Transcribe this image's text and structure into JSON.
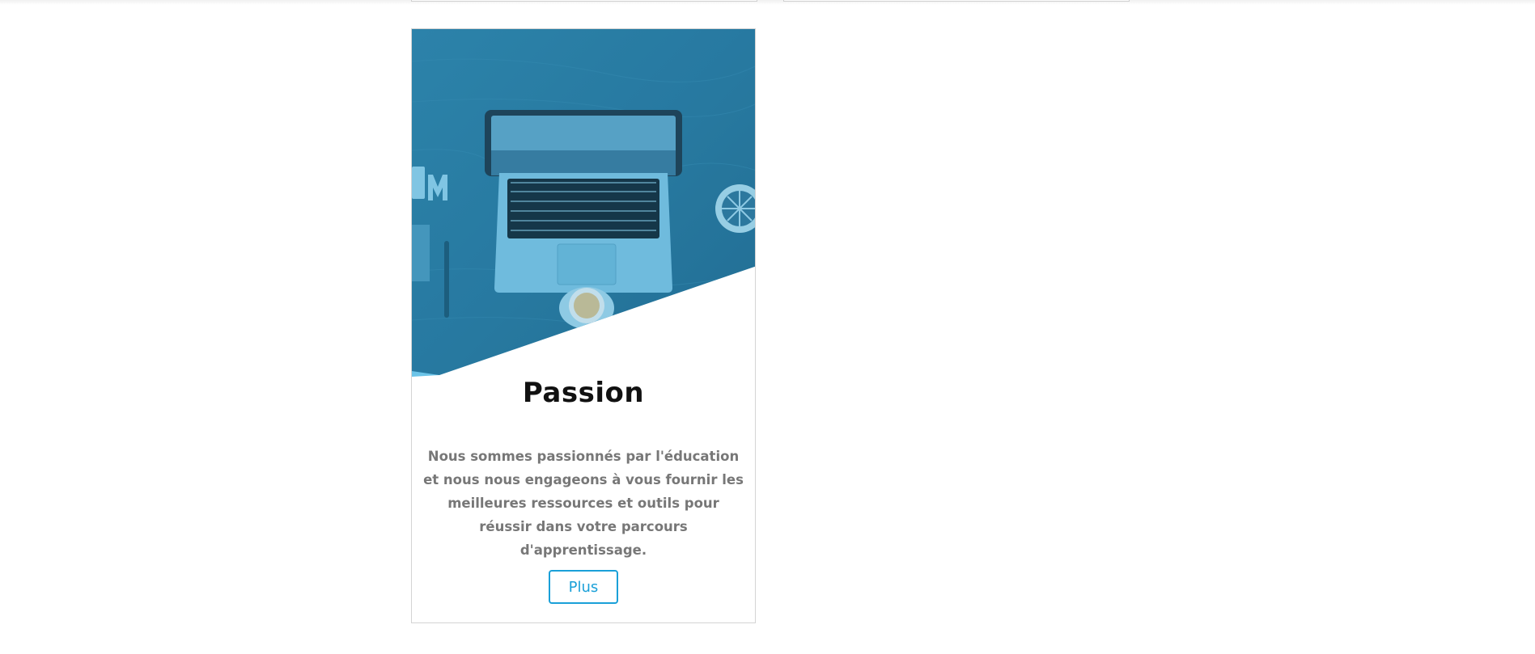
{
  "card": {
    "title": "Passion",
    "description": "Nous sommes passionnés par l'éducation et nous nous engageons à vous fournir les meilleures ressources et outils pour réussir dans votre parcours d'apprentissage.",
    "button_label": "Plus"
  },
  "colors": {
    "accent": "#1aa0d8",
    "image_tint": "#2b7ea6",
    "text_muted": "#777777",
    "title": "#111111"
  }
}
